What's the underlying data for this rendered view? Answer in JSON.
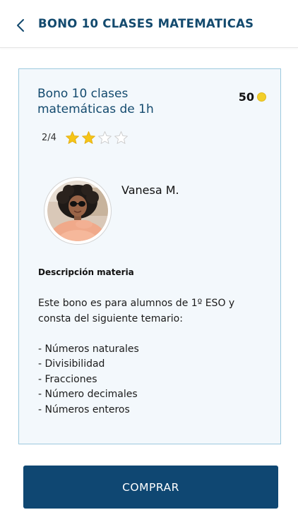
{
  "header": {
    "title": "BONO 10 CLASES MATEMATICAS",
    "back_icon": "chevron-left-icon"
  },
  "product": {
    "title": "Bono 10 clases matemáticas  de 1h",
    "price": "50",
    "price_icon": "coin-icon",
    "rating_text": "2/4",
    "rating": 2,
    "rating_max": 4,
    "star_count": 4
  },
  "tutor": {
    "name": "Vanesa M."
  },
  "description": {
    "heading": "Descripción materia",
    "intro": "Este bono es para alumnos de 1º ESO y consta del siguiente temario:",
    "topics": [
      "- Números naturales",
      "- Divisibilidad",
      "- Fracciones",
      "- Número decimales",
      "- Números enteros"
    ]
  },
  "actions": {
    "buy_label": "COMPRAR"
  },
  "colors": {
    "brand": "#134a6e",
    "button": "#0f4772",
    "card_bg": "#f3f8fc",
    "card_border": "#9cc9de",
    "star_filled": "#f5c518",
    "coin": "#f2cf2a"
  }
}
